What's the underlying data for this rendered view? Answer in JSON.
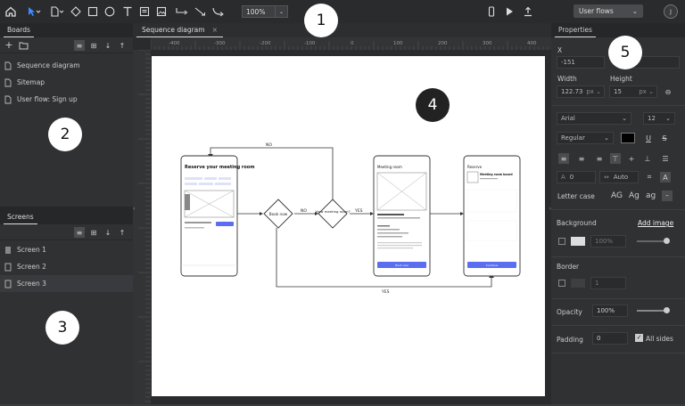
{
  "topbar": {
    "zoom": "100%",
    "flows_select": "User flows",
    "avatar_initial": "J"
  },
  "annotations": [
    "1",
    "2",
    "3",
    "4",
    "5"
  ],
  "boards": {
    "title": "Boards",
    "items": [
      {
        "label": "Sequence diagram"
      },
      {
        "label": "Sitemap"
      },
      {
        "label": "User flow: Sign up"
      }
    ]
  },
  "screens": {
    "title": "Screens",
    "items": [
      {
        "label": "Screen 1"
      },
      {
        "label": "Screen 2"
      },
      {
        "label": "Screen 3"
      }
    ]
  },
  "canvas": {
    "tab_label": "Sequence diagram",
    "ruler_labels": [
      "-400",
      "-300",
      "-200",
      "-100",
      "0",
      "100",
      "200",
      "300",
      "400"
    ],
    "diagram": {
      "screen1_title": "Reserve your meeting room",
      "decision1": "Book now",
      "decision2": "View meeting room?",
      "label_no_top": "NO",
      "label_no_mid": "NO",
      "label_yes_mid": "YES",
      "label_yes_bottom": "YES",
      "screen2_header": "Meeting room",
      "screen3_header": "Reserve",
      "screen3_title": "Meeting room board",
      "button_book": "Book now",
      "button_continue": "Continue"
    }
  },
  "properties": {
    "title": "Properties",
    "x_label": "X",
    "x_value": "-151",
    "y_value": "",
    "width_label": "Width",
    "width_value": "122.73",
    "width_unit": "px",
    "height_label": "Height",
    "height_value": "15",
    "height_unit": "px",
    "font_family": "Arial",
    "font_size": "12",
    "font_style": "Regular",
    "line_height_value": "0",
    "auto_value": "Auto",
    "letter_case_label": "Letter case",
    "letter_case_options": [
      "AG",
      "Ag",
      "ag",
      "–"
    ],
    "background_label": "Background",
    "add_image_label": "Add image",
    "background_opacity": "100%",
    "border_label": "Border",
    "border_value": "1",
    "opacity_label": "Opacity",
    "opacity_value": "100%",
    "padding_label": "Padding",
    "padding_value": "0",
    "all_sides_label": "All sides"
  }
}
